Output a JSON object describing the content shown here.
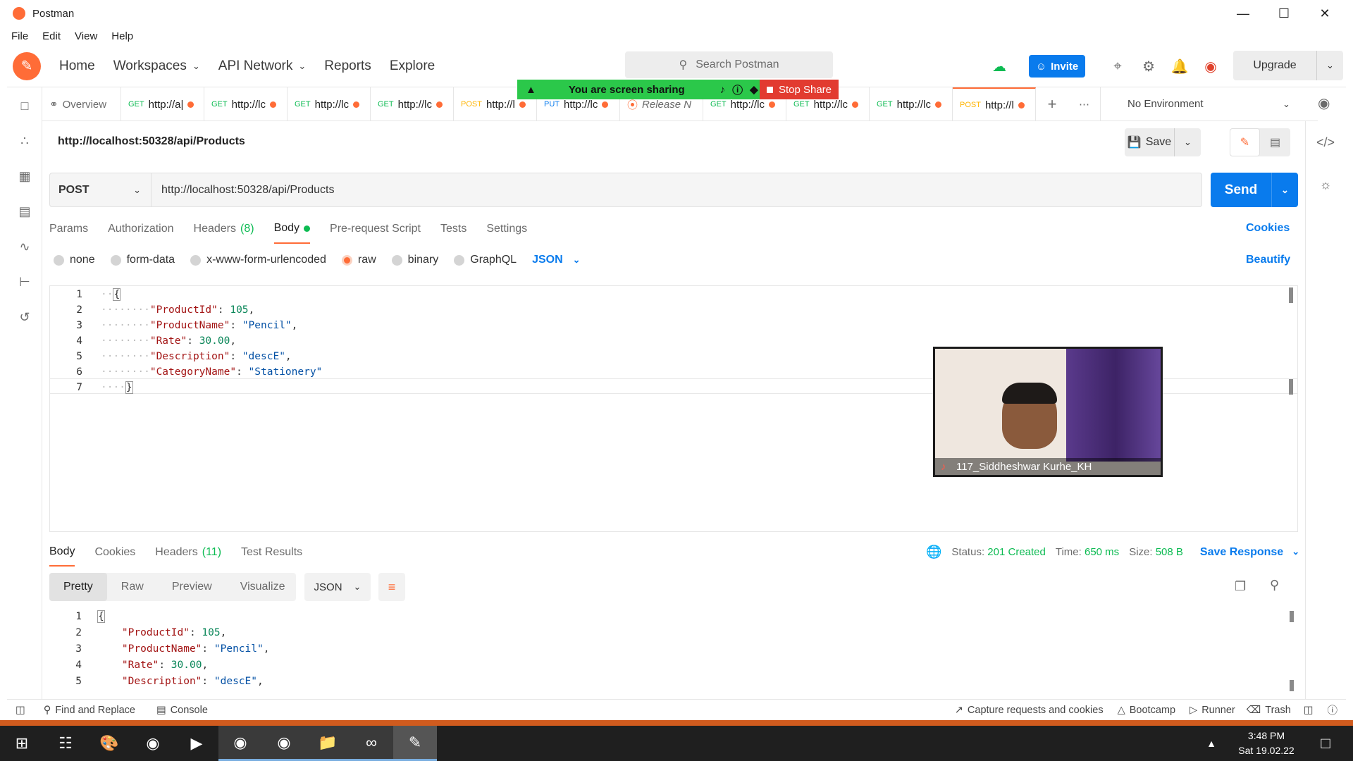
{
  "window": {
    "title": "Postman"
  },
  "menu": [
    "File",
    "Edit",
    "View",
    "Help"
  ],
  "header": {
    "nav": [
      "Home",
      "Workspaces",
      "API Network",
      "Reports",
      "Explore"
    ],
    "search_placeholder": "Search Postman",
    "invite_label": "Invite",
    "upgrade_label": "Upgrade"
  },
  "share_bar": {
    "sharing_text": "You are screen sharing",
    "stop_label": "Stop Share"
  },
  "tabs": [
    {
      "method": "",
      "label": "Overview"
    },
    {
      "method": "GET",
      "label": "http://a|"
    },
    {
      "method": "GET",
      "label": "http://lc"
    },
    {
      "method": "GET",
      "label": "http://lc"
    },
    {
      "method": "GET",
      "label": "http://lc"
    },
    {
      "method": "POST",
      "label": "http://l"
    },
    {
      "method": "PUT",
      "label": "http://lc"
    },
    {
      "method": "",
      "label": "Release N"
    },
    {
      "method": "GET",
      "label": "http://lc"
    },
    {
      "method": "GET",
      "label": "http://lc"
    },
    {
      "method": "GET",
      "label": "http://lc"
    },
    {
      "method": "POST",
      "label": "http://l"
    }
  ],
  "environment": "No Environment",
  "request": {
    "title": "http://localhost:50328/api/Products",
    "method": "POST",
    "url": "http://localhost:50328/api/Products",
    "save_label": "Save",
    "send_label": "Send"
  },
  "request_tabs": {
    "params": "Params",
    "authorization": "Authorization",
    "headers": "Headers",
    "headers_count": "(8)",
    "body": "Body",
    "prerequest": "Pre-request Script",
    "tests": "Tests",
    "settings": "Settings",
    "cookies": "Cookies",
    "beautify": "Beautify"
  },
  "body_types": [
    "none",
    "form-data",
    "x-www-form-urlencoded",
    "raw",
    "binary",
    "GraphQL"
  ],
  "body_format": "JSON",
  "request_body": {
    "line_numbers": [
      "1",
      "2",
      "3",
      "4",
      "5",
      "6",
      "7"
    ],
    "open": "{",
    "close": "}",
    "fields": [
      {
        "key": "\"ProductId\"",
        "value": "105",
        "type": "num",
        "comma": ","
      },
      {
        "key": "\"ProductName\"",
        "value": "\"Pencil\"",
        "type": "str",
        "comma": ","
      },
      {
        "key": "\"Rate\"",
        "value": "30.00",
        "type": "num",
        "comma": ","
      },
      {
        "key": "\"Description\"",
        "value": "\"descE\"",
        "type": "str",
        "comma": ","
      },
      {
        "key": "\"CategoryName\"",
        "value": "\"Stationery\"",
        "type": "str",
        "comma": ""
      }
    ]
  },
  "webcam": {
    "name": "117_Siddheshwar Kurhe_KH"
  },
  "response": {
    "tabs": {
      "body": "Body",
      "cookies": "Cookies",
      "headers": "Headers",
      "headers_count": "(11)",
      "tests": "Test Results"
    },
    "status_label": "Status:",
    "status_value": "201 Created",
    "time_label": "Time:",
    "time_value": "650 ms",
    "size_label": "Size:",
    "size_value": "508 B",
    "save_response": "Save Response",
    "views": [
      "Pretty",
      "Raw",
      "Preview",
      "Visualize"
    ],
    "format": "JSON",
    "line_numbers": [
      "1",
      "2",
      "3",
      "4",
      "5"
    ],
    "open": "{",
    "fields": [
      {
        "key": "\"ProductId\"",
        "value": "105",
        "type": "num",
        "comma": ","
      },
      {
        "key": "\"ProductName\"",
        "value": "\"Pencil\"",
        "type": "str",
        "comma": ","
      },
      {
        "key": "\"Rate\"",
        "value": "30.00",
        "type": "num",
        "comma": ","
      },
      {
        "key": "\"Description\"",
        "value": "\"descE\"",
        "type": "str",
        "comma": ","
      }
    ]
  },
  "statusbar": {
    "find_replace": "Find and Replace",
    "console": "Console",
    "capture": "Capture requests and cookies",
    "bootcamp": "Bootcamp",
    "runner": "Runner",
    "trash": "Trash"
  },
  "taskbar": {
    "time": "3:48 PM",
    "date": "Sat 19.02.22"
  },
  "colors": {
    "accent": "#ff6c37",
    "primary": "#097bed",
    "success": "#0cbb52",
    "share_green": "#2bc84a",
    "stop_red": "#e23b30"
  }
}
